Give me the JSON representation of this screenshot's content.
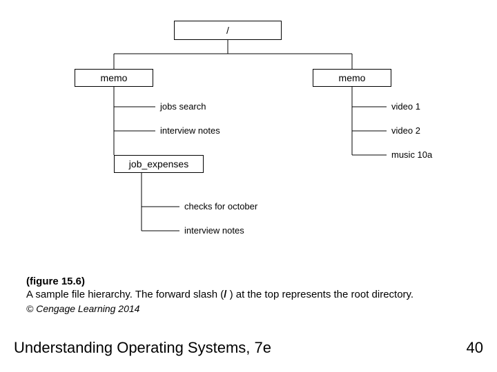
{
  "root_label": "/",
  "left_memo_label": "memo",
  "right_memo_label": "memo",
  "left_children": [
    "jobs search",
    "interview notes"
  ],
  "left_subbox_label": "job_expenses",
  "left_subbox_children": [
    "checks for october",
    "interview notes"
  ],
  "right_children": [
    "video 1",
    "video 2",
    "music 10a"
  ],
  "figure_label": "(figure 15.6)",
  "caption_pre": "A sample file hierarchy. The forward slash (",
  "caption_bold": "/",
  "caption_post": " ) at the top represents the root directory.",
  "copyright": "© Cengage Learning 2014",
  "book_title": "Understanding Operating Systems, 7e",
  "page_number": "40"
}
